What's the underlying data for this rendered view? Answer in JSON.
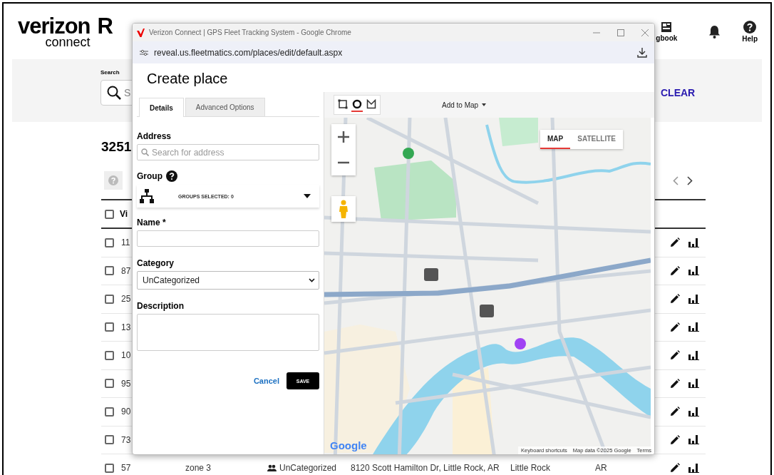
{
  "header": {
    "logo_word": "verizon",
    "logo_sub": "connect",
    "app_initial": "R",
    "logbook_label": "gbook",
    "help_label": "Help"
  },
  "search": {
    "label": "Search",
    "placeholder": "S",
    "clear": "CLEAR"
  },
  "list": {
    "count": "3251"
  },
  "table": {
    "select_all_checked": false,
    "columns": [
      {
        "label": "Vi"
      }
    ],
    "rows": [
      {
        "id": "11",
        "checked": false
      },
      {
        "id": "87",
        "checked": false
      },
      {
        "id": "25",
        "checked": false
      },
      {
        "id": "13",
        "checked": false
      },
      {
        "id": "10",
        "checked": false
      },
      {
        "id": "95",
        "checked": false
      },
      {
        "id": "90",
        "checked": false
      },
      {
        "id": "73",
        "checked": false
      },
      {
        "id": "57",
        "checked": false,
        "name": "zone 3",
        "category": "UnCategorized",
        "address": "8120 Scott Hamilton Dr, Little Rock, AR",
        "city": "Little Rock",
        "state": "AR"
      }
    ]
  },
  "popup": {
    "title": "Verizon Connect | GPS Fleet Tracking System - Google Chrome",
    "url": "reveal.us.fleetmatics.com/places/edit/default.aspx",
    "heading": "Create place",
    "tabs": [
      {
        "label": "Details",
        "selected": true
      },
      {
        "label": "Advanced Options",
        "selected": false
      }
    ],
    "form": {
      "address_label": "Address",
      "address_placeholder": "Search for address",
      "group_label": "Group",
      "groups_value": "GROUPS SELECTED: 0",
      "name_label": "Name *",
      "category_label": "Category",
      "category_value": "UnCategorized",
      "description_label": "Description",
      "cancel": "Cancel",
      "save": "SAVE"
    },
    "map": {
      "tools": [
        {
          "kind": "rectangle",
          "selected": false
        },
        {
          "kind": "circle",
          "selected": true
        },
        {
          "kind": "polygon",
          "selected": false
        }
      ],
      "add_to_map": "Add to Map",
      "map_types": [
        {
          "label": "MAP",
          "selected": true
        },
        {
          "label": "SATELLITE",
          "selected": false
        }
      ],
      "logo": "Google",
      "attribution": [
        "Keyboard shortcuts",
        "Map data ©2025 Google",
        "Terms"
      ]
    }
  }
}
